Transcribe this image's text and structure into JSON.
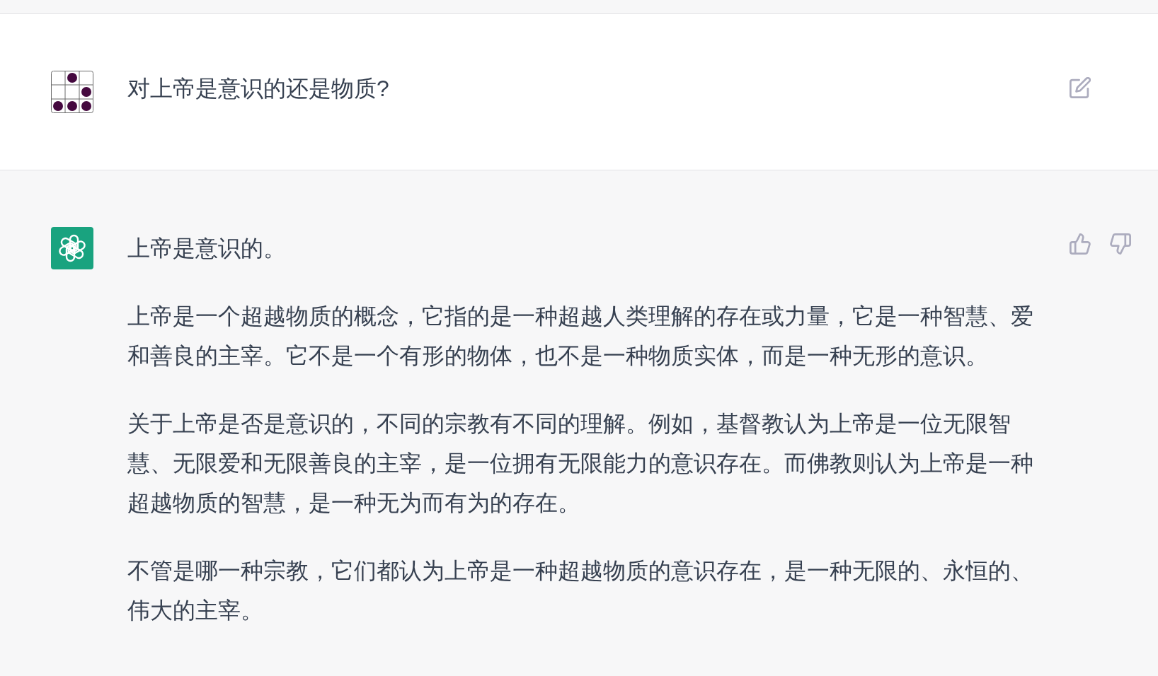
{
  "messages": [
    {
      "kind": "user",
      "paragraphs": [
        [
          "对上帝是意识的还是物质?"
        ]
      ]
    },
    {
      "kind": "assistant",
      "paragraphs": [
        [
          "上帝是意识的。"
        ],
        [
          "上帝是一个超越物质的概念，它指的是一种超越人类理解的存在或力量，它是一种智慧、爱",
          "和善良的主宰。它不是一个有形的物体，也不是一种物质实体，而是一种无形的意识。"
        ],
        [
          "关于上帝是否是意识的，不同的宗教有不同的理解。例如，基督教认为上帝是一位无限智",
          "慧、无限爱和无限善良的主宰，是一位拥有无限能力的意识存在。而佛教则认为上帝是一种",
          "超越物质的智慧，是一种无为而有为的存在。"
        ],
        [
          "不管是哪一种宗教，它们都认为上帝是一种超越物质的意识存在，是一种无限的、永恒的、",
          "伟大的主宰。"
        ]
      ]
    }
  ]
}
